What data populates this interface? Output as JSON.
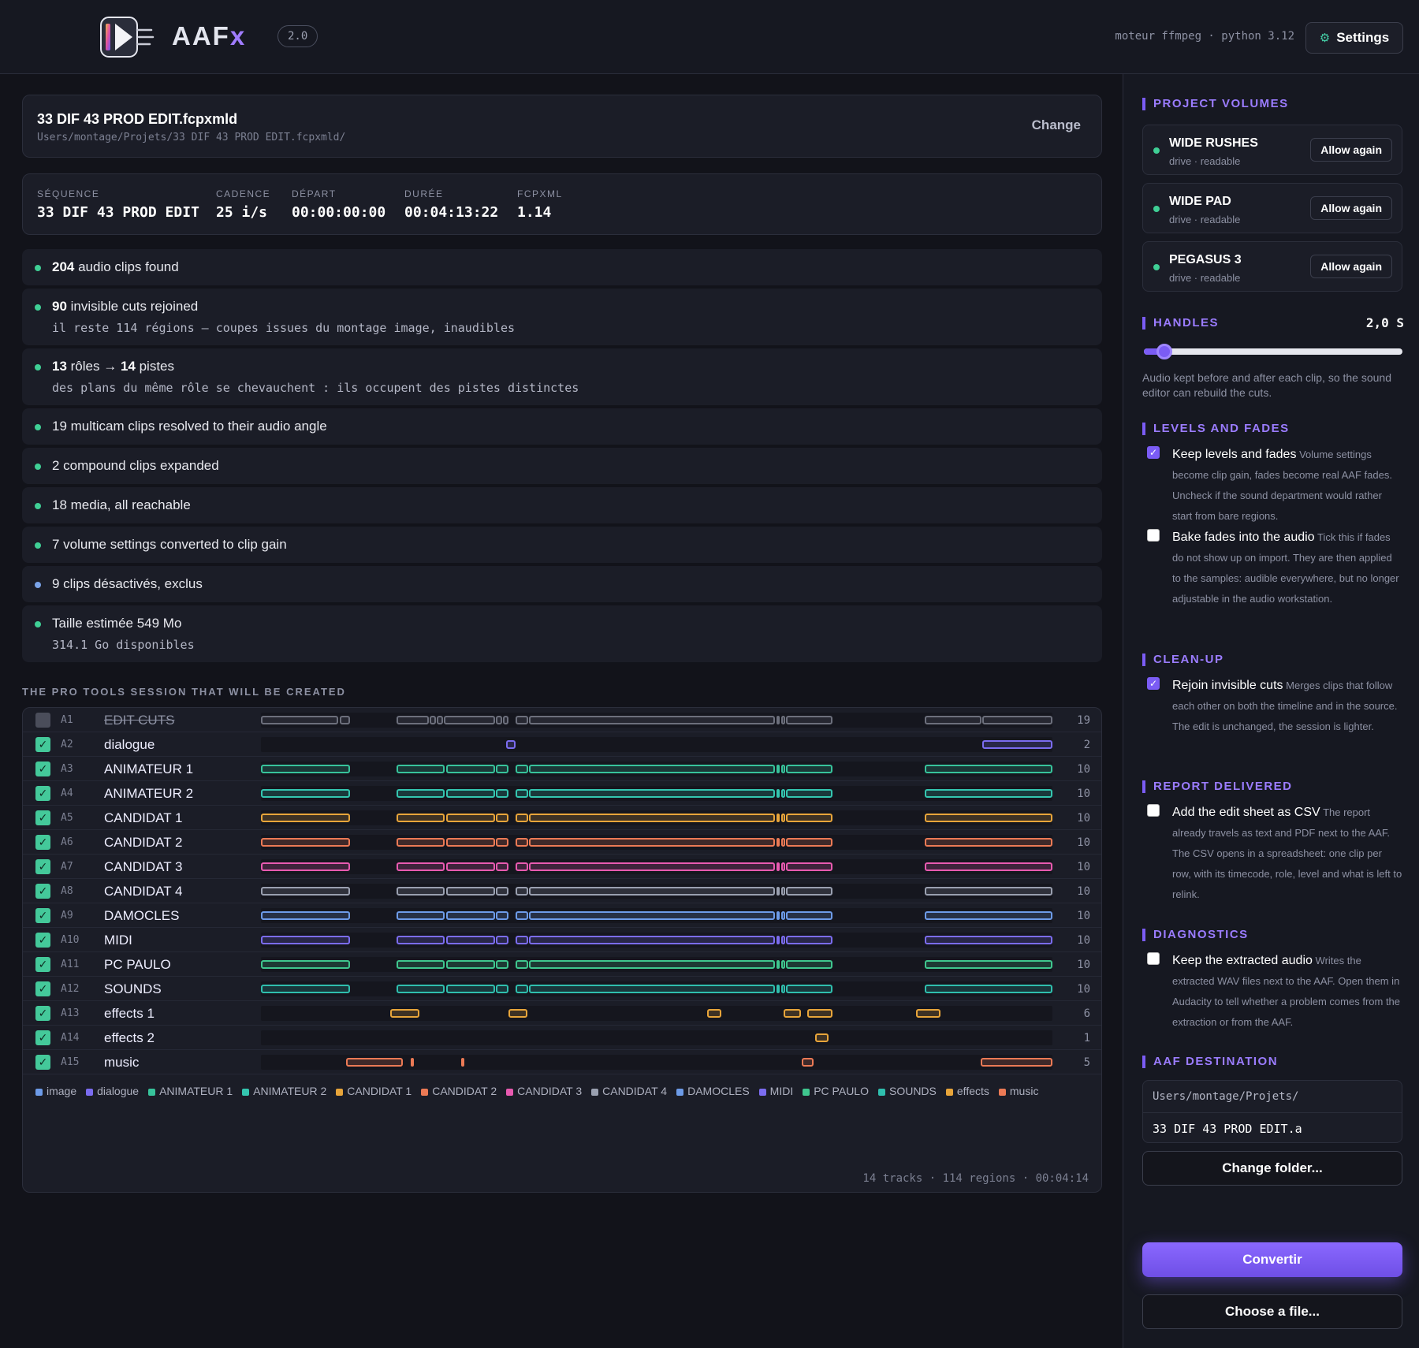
{
  "header": {
    "brand_main": "AAF",
    "brand_x": "x",
    "version": "2.0",
    "engine": "moteur ffmpeg · python 3.12",
    "settings_label": "Settings",
    "settings_icon": "gear-icon"
  },
  "file": {
    "title": "33 DIF 43 PROD EDIT.fcpxmld",
    "path": "Users/montage/Projets/33 DIF 43 PROD EDIT.fcpxmld/",
    "change_label": "Change"
  },
  "meta": [
    {
      "label": "SÉQUENCE",
      "value": "33 DIF 43 PROD EDIT"
    },
    {
      "label": "CADENCE",
      "value": "25 i/s"
    },
    {
      "label": "DÉPART",
      "value": "00:00:00:00"
    },
    {
      "label": "DURÉE",
      "value": "00:04:13:22"
    },
    {
      "label": "FCPXML",
      "value": "1.14"
    }
  ],
  "reports": {
    "r1": {
      "bold": "204",
      "text": " audio clips found"
    },
    "r2": {
      "bold": "90",
      "text": " invisible cuts rejoined",
      "sub": "il reste 114 régions — coupes issues du montage image, inaudibles"
    },
    "r3": {
      "bold1": "13",
      "text1": " rôles → ",
      "bold2": "14",
      "text2": " pistes",
      "sub": "des plans du même rôle se chevauchent : ils occupent des pistes distinctes"
    },
    "r4": {
      "text": "19 multicam clips resolved to their audio angle"
    },
    "r5": {
      "text": "2 compound clips expanded"
    },
    "r6": {
      "text": "18 media, all reachable"
    },
    "r7": {
      "text": "7 volume settings converted to clip gain"
    },
    "r8": {
      "text": "9 clips désactivés, exclus"
    },
    "r9": {
      "text": "Taille estimée 549 Mo",
      "sub": "314.1 Go disponibles"
    }
  },
  "tracks_section": {
    "title": "THE PRO TOOLS SESSION THAT WILL BE CREATED",
    "footer": "14 tracks · 114 regions · 00:04:14"
  },
  "tracks": [
    {
      "id": "A1",
      "name": "EDIT CUTS",
      "count": "19",
      "checked": false,
      "color": "#6c6f7c"
    },
    {
      "id": "A2",
      "name": "dialogue",
      "count": "2",
      "checked": true,
      "color": "#7b6cf0"
    },
    {
      "id": "A3",
      "name": "ANIMATEUR 1",
      "count": "10",
      "checked": true,
      "color": "#37c39b"
    },
    {
      "id": "A4",
      "name": "ANIMATEUR 2",
      "count": "10",
      "checked": true,
      "color": "#34c6b0"
    },
    {
      "id": "A5",
      "name": "CANDIDAT 1",
      "count": "10",
      "checked": true,
      "color": "#e8a53a"
    },
    {
      "id": "A6",
      "name": "CANDIDAT 2",
      "count": "10",
      "checked": true,
      "color": "#ec7a55"
    },
    {
      "id": "A7",
      "name": "CANDIDAT 3",
      "count": "10",
      "checked": true,
      "color": "#e85ab0"
    },
    {
      "id": "A8",
      "name": "CANDIDAT 4",
      "count": "10",
      "checked": true,
      "color": "#9aa0b0"
    },
    {
      "id": "A9",
      "name": "DAMOCLES",
      "count": "10",
      "checked": true,
      "color": "#6d9be8"
    },
    {
      "id": "A10",
      "name": "MIDI",
      "count": "10",
      "checked": true,
      "color": "#7b6cf0"
    },
    {
      "id": "A11",
      "name": "PC PAULO",
      "count": "10",
      "checked": true,
      "color": "#3fc68e"
    },
    {
      "id": "A12",
      "name": "SOUNDS",
      "count": "10",
      "checked": true,
      "color": "#2fbfae"
    },
    {
      "id": "A13",
      "name": "effects 1",
      "count": "6",
      "checked": true,
      "color": "#e8a53a"
    },
    {
      "id": "A14",
      "name": "effects 2",
      "count": "1",
      "checked": true,
      "color": "#e8a53a"
    },
    {
      "id": "A15",
      "name": "music",
      "count": "5",
      "checked": true,
      "color": "#ec7a55"
    }
  ],
  "legend": [
    {
      "label": "image",
      "color": "#6d9be8"
    },
    {
      "label": "dialogue",
      "color": "#7b6cf0"
    },
    {
      "label": "ANIMATEUR 1",
      "color": "#37c39b"
    },
    {
      "label": "ANIMATEUR 2",
      "color": "#34c6b0"
    },
    {
      "label": "CANDIDAT 1",
      "color": "#e8a53a"
    },
    {
      "label": "CANDIDAT 2",
      "color": "#ec7a55"
    },
    {
      "label": "CANDIDAT 3",
      "color": "#e85ab0"
    },
    {
      "label": "CANDIDAT 4",
      "color": "#9aa0b0"
    },
    {
      "label": "DAMOCLES",
      "color": "#6d9be8"
    },
    {
      "label": "MIDI",
      "color": "#7b6cf0"
    },
    {
      "label": "PC PAULO",
      "color": "#3fc68e"
    },
    {
      "label": "SOUNDS",
      "color": "#2fbfae"
    },
    {
      "label": "effects",
      "color": "#e8a53a"
    },
    {
      "label": "music",
      "color": "#ec7a55"
    }
  ],
  "sidebar": {
    "volumes_title": "PROJECT VOLUMES",
    "volumes": [
      {
        "name": "WIDE RUSHES",
        "sub": "drive · readable",
        "action": "Allow again"
      },
      {
        "name": "WIDE PAD",
        "sub": "drive · readable",
        "action": "Allow again"
      },
      {
        "name": "PEGASUS 3",
        "sub": "drive · readable",
        "action": "Allow again"
      }
    ],
    "handles_title": "HANDLES",
    "handles_value": "2,0 S",
    "handles_fraction": 0.08,
    "handles_help": "Audio kept before and after each clip, so the sound editor can rebuild the cuts.",
    "levels_title": "LEVELS AND FADES",
    "opt_levels_label": "Keep levels and fades",
    "opt_levels_help": "Volume settings become clip gain, fades become real AAF fades. Uncheck if the sound department would rather start from bare regions.",
    "opt_levels_checked": true,
    "opt_bake_label": "Bake fades into the audio",
    "opt_bake_help": "Tick this if fades do not show up on import. They are then applied to the samples: audible everywhere, but no longer adjustable in the audio workstation.",
    "opt_bake_checked": false,
    "cleanup_title": "CLEAN-UP",
    "opt_rejoin_label": "Rejoin invisible cuts",
    "opt_rejoin_help": "Merges clips that follow each other on both the timeline and in the source. The edit is unchanged, the session is lighter.",
    "opt_rejoin_checked": true,
    "report_title": "REPORT DELIVERED",
    "opt_csv_label": "Add the edit sheet as CSV",
    "opt_csv_help": "The report already travels as text and PDF next to the AAF. The CSV opens in a spreadsheet: one clip per row, with its timecode, role, level and what is left to relink.",
    "opt_csv_checked": false,
    "diag_title": "DIAGNOSTICS",
    "opt_keep_label": "Keep the extracted audio",
    "opt_keep_help": "Writes the extracted WAV files next to the AAF. Open them in Audacity to tell whether a problem comes from the extraction or from the AAF.",
    "opt_keep_checked": false,
    "dest_title": "AAF DESTINATION",
    "dest_folder": "Users/montage/Projets/",
    "dest_file": "33 DIF 43 PROD EDIT.a",
    "change_folder_label": "Change folder...",
    "convert_label": "Convertir",
    "choose_file_label": "Choose a file..."
  }
}
